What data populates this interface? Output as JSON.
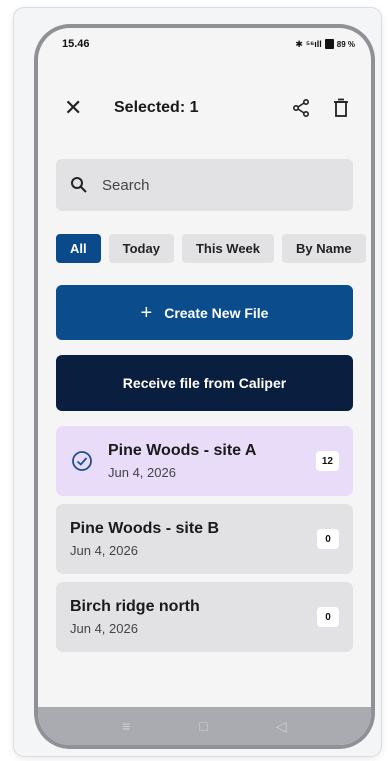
{
  "status_bar": {
    "time": "15.46",
    "bluetooth_icon": "bluetooth-icon",
    "signal_text": "⁵⁶ıll",
    "battery": "89 %"
  },
  "app_bar": {
    "title": "Selected: 1",
    "close_icon": "close-icon",
    "share_icon": "share-icon",
    "trash_icon": "trash-icon"
  },
  "search": {
    "placeholder": "Search"
  },
  "filters": [
    {
      "label": "All",
      "active": true
    },
    {
      "label": "Today",
      "active": false
    },
    {
      "label": "This Week",
      "active": false
    },
    {
      "label": "By Name",
      "active": false
    }
  ],
  "actions": {
    "create_label": "Create New File",
    "receive_label": "Receive file from Caliper"
  },
  "files": [
    {
      "name": "Pine Woods - site A",
      "date": "Jun 4, 2026",
      "count": "12",
      "selected": true
    },
    {
      "name": "Pine Woods - site B",
      "date": "Jun 4, 2026",
      "count": "0",
      "selected": false
    },
    {
      "name": "Birch ridge north",
      "date": "Jun 4, 2026",
      "count": "0",
      "selected": false
    }
  ],
  "nav": {
    "recent_icon": "≡",
    "home_icon": "□",
    "back_icon": "◁"
  },
  "colors": {
    "primary": "#0b4c8c",
    "dark": "#0a1f3f",
    "selected_item": "#e8dcf8"
  }
}
